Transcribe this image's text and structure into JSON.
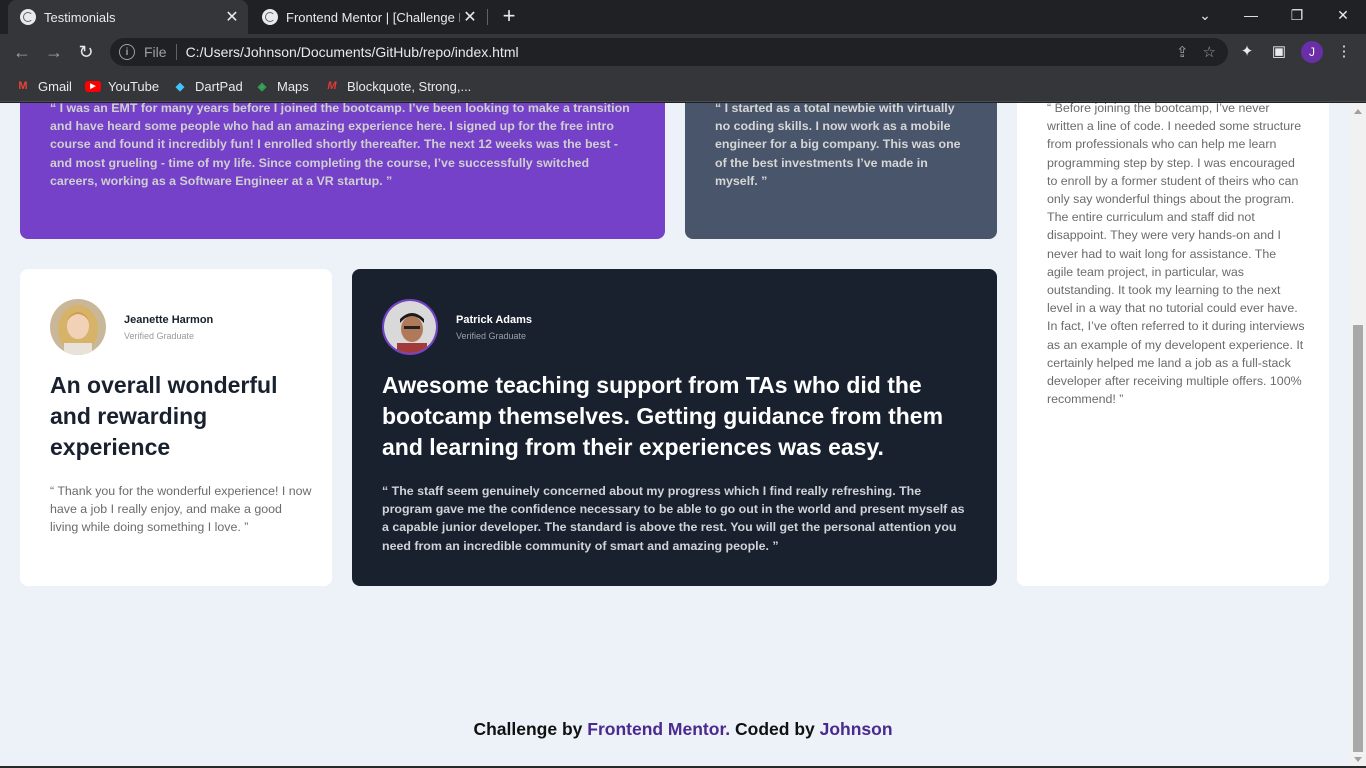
{
  "browser": {
    "tabs": [
      {
        "title": "Testimonials",
        "active": true
      },
      {
        "title": "Frontend Mentor | [Challenge Na",
        "active": false
      }
    ],
    "new_tab_label": "+",
    "address": {
      "scheme": "File",
      "url": "C:/Users/Johnson/Documents/GitHub/repo/index.html"
    },
    "profile_initial": "J",
    "bookmarks": [
      {
        "label": "Gmail",
        "icon": "gmail-icon"
      },
      {
        "label": "YouTube",
        "icon": "youtube-icon"
      },
      {
        "label": "DartPad",
        "icon": "dartpad-icon"
      },
      {
        "label": "Maps",
        "icon": "maps-icon"
      },
      {
        "label": "Blockquote, Strong,...",
        "icon": "bookmark-site-icon"
      }
    ]
  },
  "testimonials": {
    "purple_card": {
      "quote": "“ I was an EMT for many years before I joined the bootcamp. I’ve been looking to make a transition and have heard some people who had an amazing experience here. I signed up for the free intro course and found it incredibly fun! I enrolled shortly thereafter. The next 12 weeks was the best - and most grueling - time of my life. Since completing the course, I’ve successfully switched careers, working as a Software Engineer at a VR startup. ”"
    },
    "gray_card": {
      "quote": "“ I started as a total newbie with virtually no coding skills. I now work as a mobile engineer for a big company. This was one of the best investments I’ve made in myself. ”"
    },
    "tall_card": {
      "quote": "“ Before joining the bootcamp, I’ve never written a line of code. I needed some structure from professionals who can help me learn programming step by step. I was encouraged to enroll by a former student of theirs who can only say wonderful things about the program. The entire curriculum and staff did not disappoint. They were very hands-on and I never had to wait long for assistance. The agile team project, in particular, was outstanding. It took my learning to the next level in a way that no tutorial could ever have. In fact, I’ve often referred to it during interviews as an example of my developent experience. It certainly helped me land a job as a full-stack developer after receiving multiple offers. 100% recommend! ”"
    },
    "jeanette": {
      "name": "Jeanette Harmon",
      "role": "Verified Graduate",
      "headline": "An overall wonderful and rewarding experience",
      "quote": "“ Thank you for the wonderful experience! I now have a job I really enjoy, and make a good living while doing something I love. ”"
    },
    "patrick": {
      "name": "Patrick Adams",
      "role": "Verified Graduate",
      "headline": "Awesome teaching support from TAs who did the bootcamp themselves. Getting guidance from them and learning from their experiences was easy.",
      "quote": "“ The staff seem genuinely concerned about my progress which I find really refreshing. The program gave me the confidence necessary to be able to go out in the world and present myself as a capable junior developer. The standard is above the rest. You will get the personal attention you need from an incredible community of smart and amazing people. ”"
    }
  },
  "attribution": {
    "prefix": "Challenge by ",
    "link1": "Frontend Mentor.",
    "middle": " Coded by ",
    "link2": "Johnson"
  },
  "colors": {
    "purple": "#7541c8",
    "slate": "#48556a",
    "dark": "#19212e",
    "page_bg": "#ecf2f8",
    "link": "#4b2a8f"
  }
}
